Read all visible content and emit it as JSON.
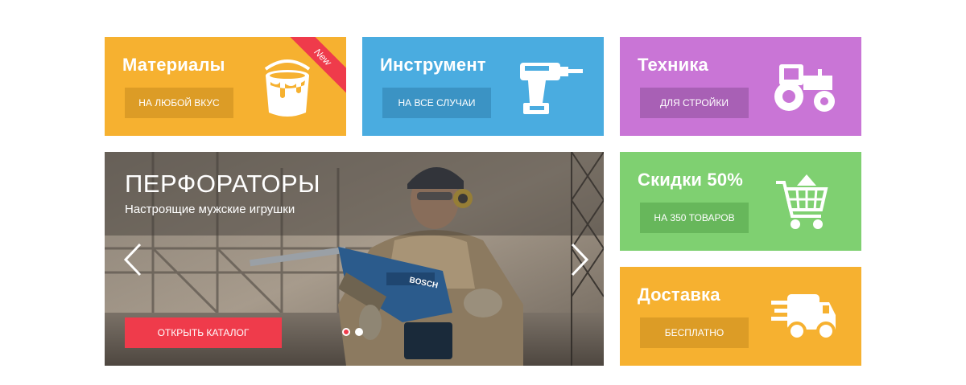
{
  "tiles": {
    "materials": {
      "title": "Материалы",
      "button": "На любой вкус",
      "badge": "New",
      "color": "#f6b130",
      "button_color": "#dc9c26",
      "icon": "paint-bucket-icon"
    },
    "tools": {
      "title": "Инструмент",
      "button": "На все случаи",
      "color": "#4aace0",
      "button_color": "#3b93c4",
      "icon": "drill-icon"
    },
    "machinery": {
      "title": "Техника",
      "button": "Для стройки",
      "color": "#c975d6",
      "button_color": "#a860b5",
      "icon": "tractor-icon"
    },
    "discounts": {
      "title": "Скидки 50%",
      "button": "На 350 товаров",
      "color": "#7fd071",
      "button_color": "#67b75b",
      "icon": "shopping-cart-icon"
    },
    "delivery": {
      "title": "Доставка",
      "button": "Бесплатно",
      "color": "#f6b130",
      "button_color": "#dc9c26",
      "icon": "delivery-truck-icon"
    }
  },
  "slider": {
    "title": "ПЕРФОРАТОРЫ",
    "subtitle": "Настроящие мужские игрушки",
    "cta": "Открыть каталог",
    "drill_brand": "BOSCH",
    "slides_total": 2,
    "active_slide": 1,
    "cta_color": "#ef3b4b",
    "active_dot_color": "#ef3b4b"
  }
}
